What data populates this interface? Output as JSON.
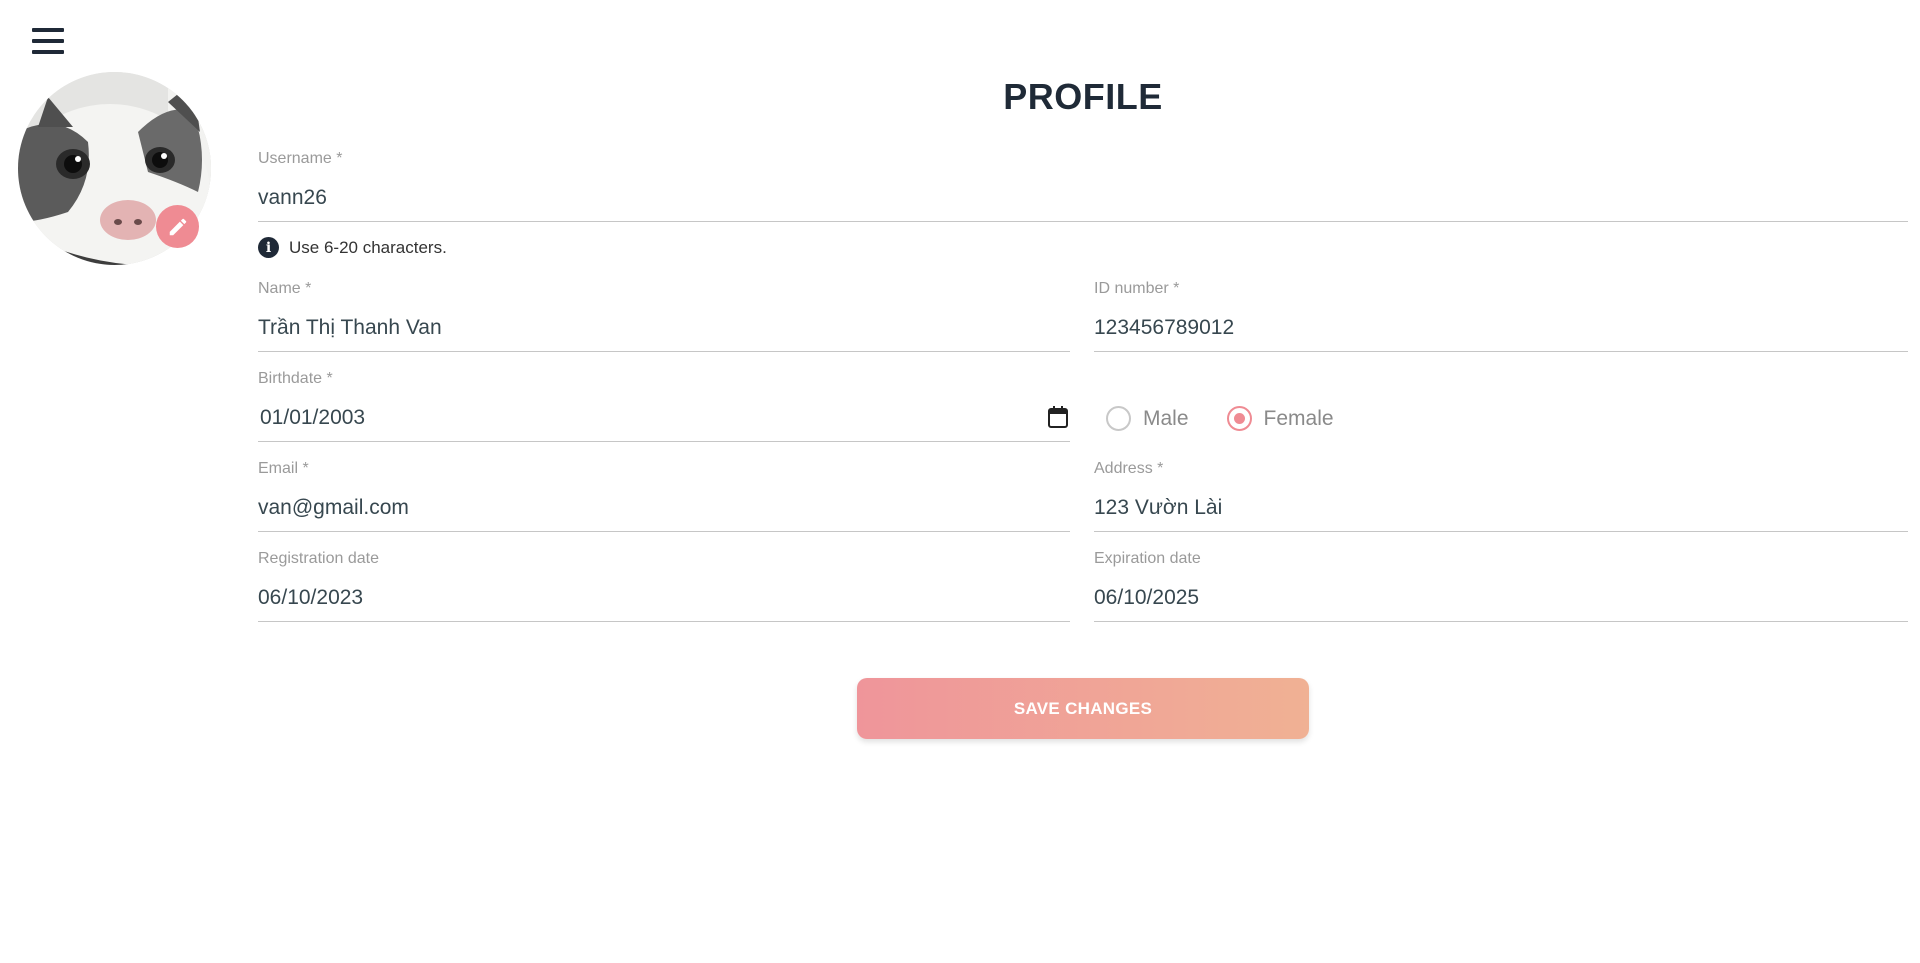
{
  "page": {
    "title": "PROFILE"
  },
  "profile": {
    "username": {
      "label": "Username *",
      "value": "vann26",
      "hint": "Use 6-20 characters."
    },
    "name": {
      "label": "Name *",
      "value": "Trần Thị Thanh Van"
    },
    "id_number": {
      "label": "ID number *",
      "value": "123456789012"
    },
    "birthdate": {
      "label": "Birthdate *",
      "value": "01/01/2003"
    },
    "gender": {
      "options": [
        "Male",
        "Female"
      ],
      "selected": "Female"
    },
    "email": {
      "label": "Email *",
      "value": "van@gmail.com"
    },
    "address": {
      "label": "Address *",
      "value": "123 Vườn Lài"
    },
    "registration_date": {
      "label": "Registration date",
      "value": "06/10/2023"
    },
    "expiration_date": {
      "label": "Expiration date",
      "value": "06/10/2025"
    }
  },
  "actions": {
    "save_label": "SAVE CHANGES"
  },
  "icons": {
    "menu": "hamburger-menu-icon",
    "edit": "pencil-icon",
    "info": "info-icon",
    "calendar": "calendar-icon"
  },
  "colors": {
    "accent": "#ef8b93",
    "gradient_start": "#ef959a",
    "gradient_end": "#f0b194",
    "title": "#1f2a37"
  }
}
